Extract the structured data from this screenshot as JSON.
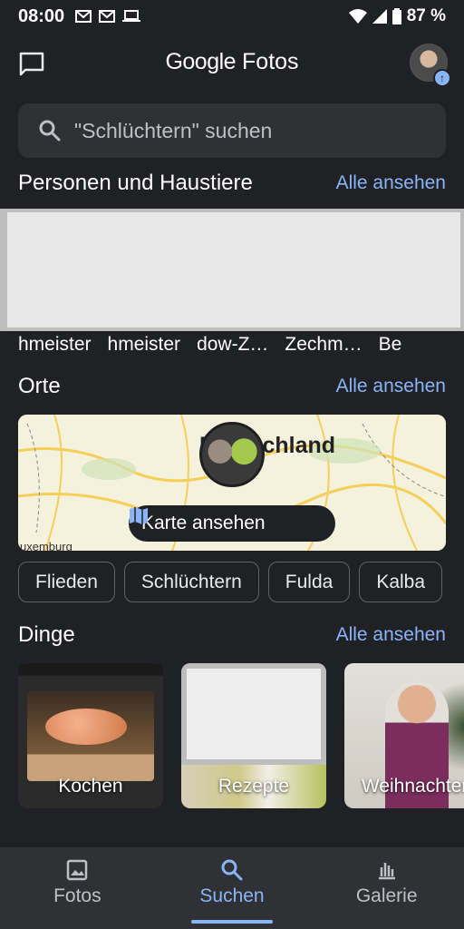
{
  "status_bar": {
    "time": "08:00",
    "battery": "87 %"
  },
  "app_bar": {
    "title_brand": "Google",
    "title_product": "Fotos"
  },
  "search": {
    "placeholder": "\"Schlüchtern\" suchen"
  },
  "people": {
    "heading": "Personen und Haustiere",
    "see_all": "Alle ansehen",
    "names": [
      "hmeister",
      "hmeister",
      "dow-Z…",
      "Zechm…",
      "Be"
    ]
  },
  "places": {
    "heading": "Orte",
    "see_all": "Alle ansehen",
    "map_country": "Deutschland",
    "map_corner_label": "uxemburg",
    "map_button": "Karte ansehen",
    "chips": [
      "Flieden",
      "Schlüchtern",
      "Fulda",
      "Kalba"
    ]
  },
  "things": {
    "heading": "Dinge",
    "see_all": "Alle ansehen",
    "items": [
      {
        "label": "Kochen"
      },
      {
        "label": "Rezepte"
      },
      {
        "label": "Weihnachten"
      }
    ]
  },
  "bottom_nav": [
    {
      "label": "Fotos",
      "icon": "photo-icon"
    },
    {
      "label": "Suchen",
      "icon": "search-icon",
      "active": true
    },
    {
      "label": "Galerie",
      "icon": "library-icon"
    }
  ],
  "colors": {
    "background": "#202124",
    "accent": "#8ab4f8",
    "surface": "#303134"
  }
}
